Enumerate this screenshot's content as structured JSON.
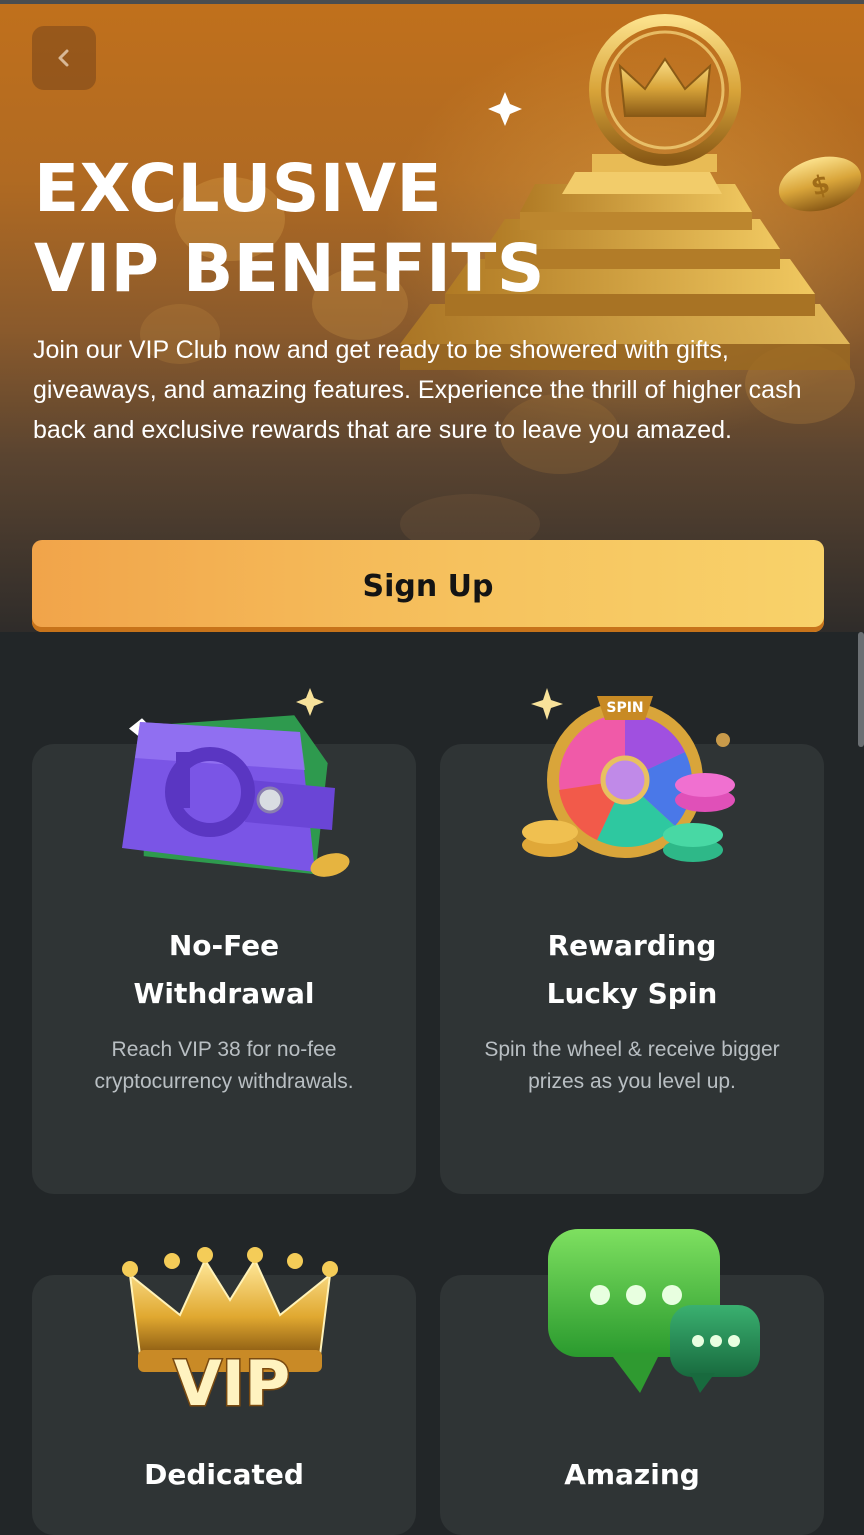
{
  "hero": {
    "title_line1": "EXCLUSIVE",
    "title_line2": "VIP BENEFITS",
    "description": "Join our VIP Club now and get ready to be showered with gifts, giveaways, and amazing features. Experience the thrill of higher cash back and exclusive rewards that are sure to leave you amazed.",
    "signup_label": "Sign Up",
    "back_icon": "chevron-left-icon"
  },
  "benefits": [
    {
      "title_line1": "No-Fee",
      "title_line2": "Withdrawal",
      "description_line1": "Reach VIP 38 for no-fee",
      "description_line2": "cryptocurrency withdrawals.",
      "icon": "wallet-icon"
    },
    {
      "title_line1": "Rewarding",
      "title_line2": "Lucky Spin",
      "description_line1": "Spin the wheel & receive bigger",
      "description_line2": "prizes as you level up.",
      "wheel_label": "SPIN",
      "icon": "spin-wheel-icon"
    },
    {
      "title_line1": "Dedicated",
      "badge_text": "VIP",
      "icon": "vip-crown-icon"
    },
    {
      "title_line1": "Amazing",
      "icon": "chat-bubble-icon"
    }
  ],
  "colors": {
    "hero_top": "#c0701c",
    "button_start": "#f1a44a",
    "button_end": "#f8d26a",
    "page_bg": "#222628",
    "card_bg": "#2f3435"
  }
}
